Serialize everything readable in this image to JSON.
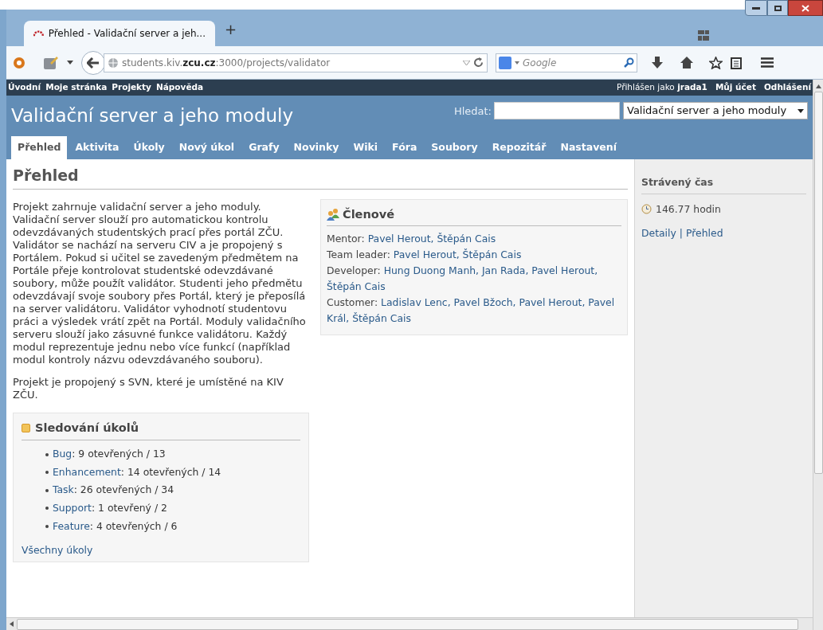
{
  "browser": {
    "tab_title": "Přehled - Validační server a jeh...",
    "new_tab": "+",
    "url_host_pre": "students.kiv.",
    "url_host_bold": "zcu.cz",
    "url_rest": ":3000/projects/validator",
    "search_placeholder": "Google"
  },
  "top_menu": {
    "left": [
      "Úvodní",
      "Moje stránka",
      "Projekty",
      "Nápověda"
    ],
    "logged_in_prefix": "Přihlášen jako",
    "user": "jrada1",
    "right": [
      "Můj účet",
      "Odhlášení"
    ]
  },
  "header": {
    "title": "Validační server a jeho moduly",
    "search_label": "Hledat:",
    "project_select": "Validační server a jeho moduly"
  },
  "tabs": [
    {
      "label": "Přehled",
      "selected": true
    },
    {
      "label": "Aktivita",
      "selected": false
    },
    {
      "label": "Úkoly",
      "selected": false
    },
    {
      "label": "Nový úkol",
      "selected": false
    },
    {
      "label": "Grafy",
      "selected": false
    },
    {
      "label": "Novinky",
      "selected": false
    },
    {
      "label": "Wiki",
      "selected": false
    },
    {
      "label": "Fóra",
      "selected": false
    },
    {
      "label": "Soubory",
      "selected": false
    },
    {
      "label": "Repozitář",
      "selected": false
    },
    {
      "label": "Nastavení",
      "selected": false
    }
  ],
  "page_title": "Přehled",
  "description": [
    "Projekt zahrnuje validační server a jeho moduly. Validační server slouží pro automatickou kontrolu odevzdávaných studentských prací přes portál ZČU. Validátor se nachází na serveru CIV a je propojený s Portálem. Pokud si učitel se zavedeným předmětem na Portále přeje kontrolovat studentské odevzdávané soubory, může použít validátor. Studenti jeho předmětu odevzdávají svoje soubory přes Portál, který je přeposílá na server validátoru. Validátor vyhodnotí studentovu práci a výsledek vrátí zpět na Portál. Moduly validačního serveru slouží jako zásuvné funkce validátoru. Každý modul reprezentuje jednu nebo více funkcí (například modul kontroly názvu odevzdávaného souboru).",
    "Projekt je propojený s SVN, které je umístěné na KIV ZČU."
  ],
  "issue_tracking": {
    "title": "Sledování úkolů",
    "items": [
      {
        "tracker": "Bug",
        "counts": ": 9 otevřených / 13"
      },
      {
        "tracker": "Enhancement",
        "counts": ": 14 otevřených / 14"
      },
      {
        "tracker": "Task",
        "counts": ": 26 otevřených / 34"
      },
      {
        "tracker": "Support",
        "counts": ": 1 otevřený / 2"
      },
      {
        "tracker": "Feature",
        "counts": ": 4 otevřených / 6"
      }
    ],
    "all_link": "Všechny úkoly"
  },
  "members": {
    "title": "Členové",
    "roles": [
      {
        "role": "Mentor:",
        "names": "Pavel Herout, Štěpán Cais"
      },
      {
        "role": "Team leader:",
        "names": "Pavel Herout, Štěpán Cais"
      },
      {
        "role": "Developer:",
        "names": "Hung Duong Manh, Jan Rada, Pavel Herout, Štěpán Cais"
      },
      {
        "role": "Customer:",
        "names": "Ladislav Lenc, Pavel Bžoch, Pavel Herout, Pavel Král, Štěpán Cais"
      }
    ]
  },
  "sidebar": {
    "title": "Strávený čas",
    "hours": "146.77 hodin",
    "links": [
      "Detaily",
      "Přehled"
    ],
    "separator": "|"
  }
}
